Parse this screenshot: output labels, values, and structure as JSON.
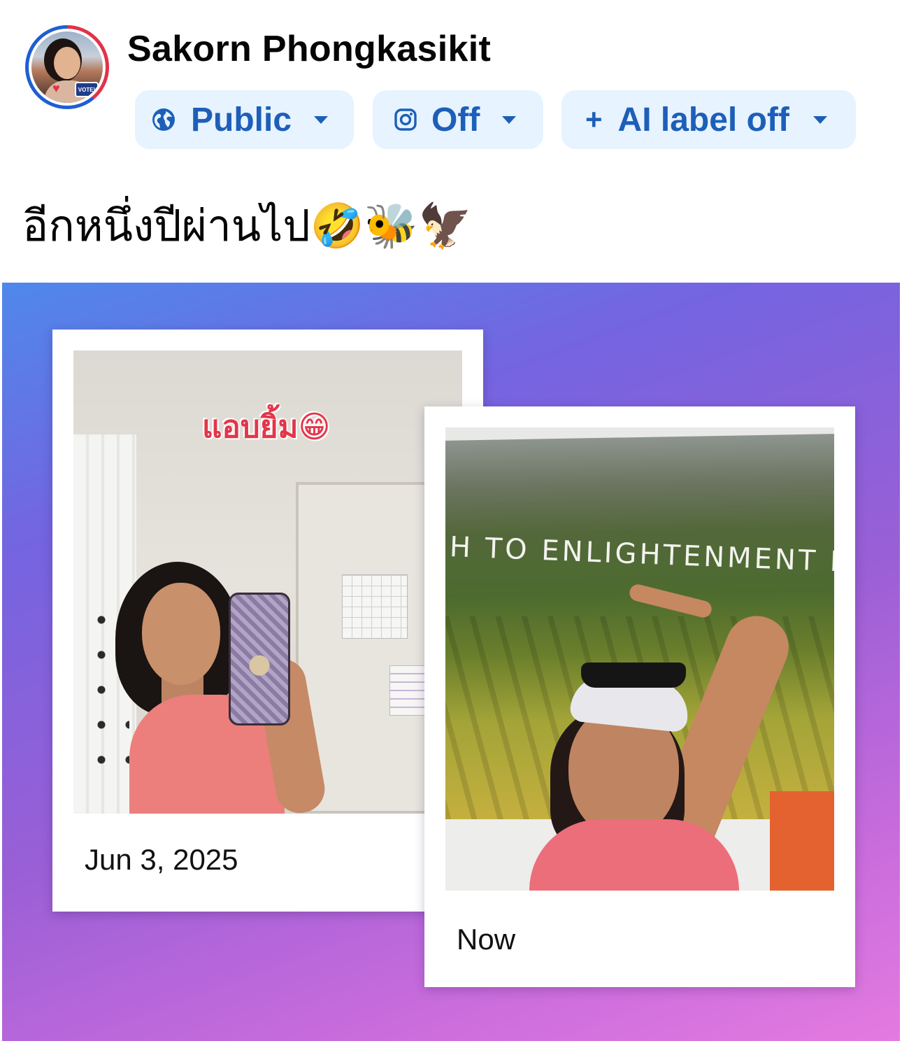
{
  "author": {
    "name": "Sakorn Phongkasikit",
    "avatar_badge": "VOTE!"
  },
  "audience": {
    "public_label": "Public",
    "instagram_label": "Off",
    "ai_label": "AI label off"
  },
  "post": {
    "text": "อีกหนึ่งปีผ่านไป🤣🐝🦅"
  },
  "memories": [
    {
      "caption": "Jun 3, 2025",
      "sticker_text": "แอบยิ้ม😁"
    },
    {
      "caption": "Now",
      "slogan_text": "H TO ENLIGHTENMENT IS"
    }
  ],
  "colors": {
    "pill_background": "#e7f3ff",
    "pill_text": "#1d5fb8",
    "card_gradient_start": "#4f88ea",
    "card_gradient_end": "#e47ae0"
  },
  "icons": {
    "audience": "globe-icon",
    "instagram": "instagram-icon",
    "ai_label": "plus-icon",
    "dropdown": "caret-down-icon"
  }
}
